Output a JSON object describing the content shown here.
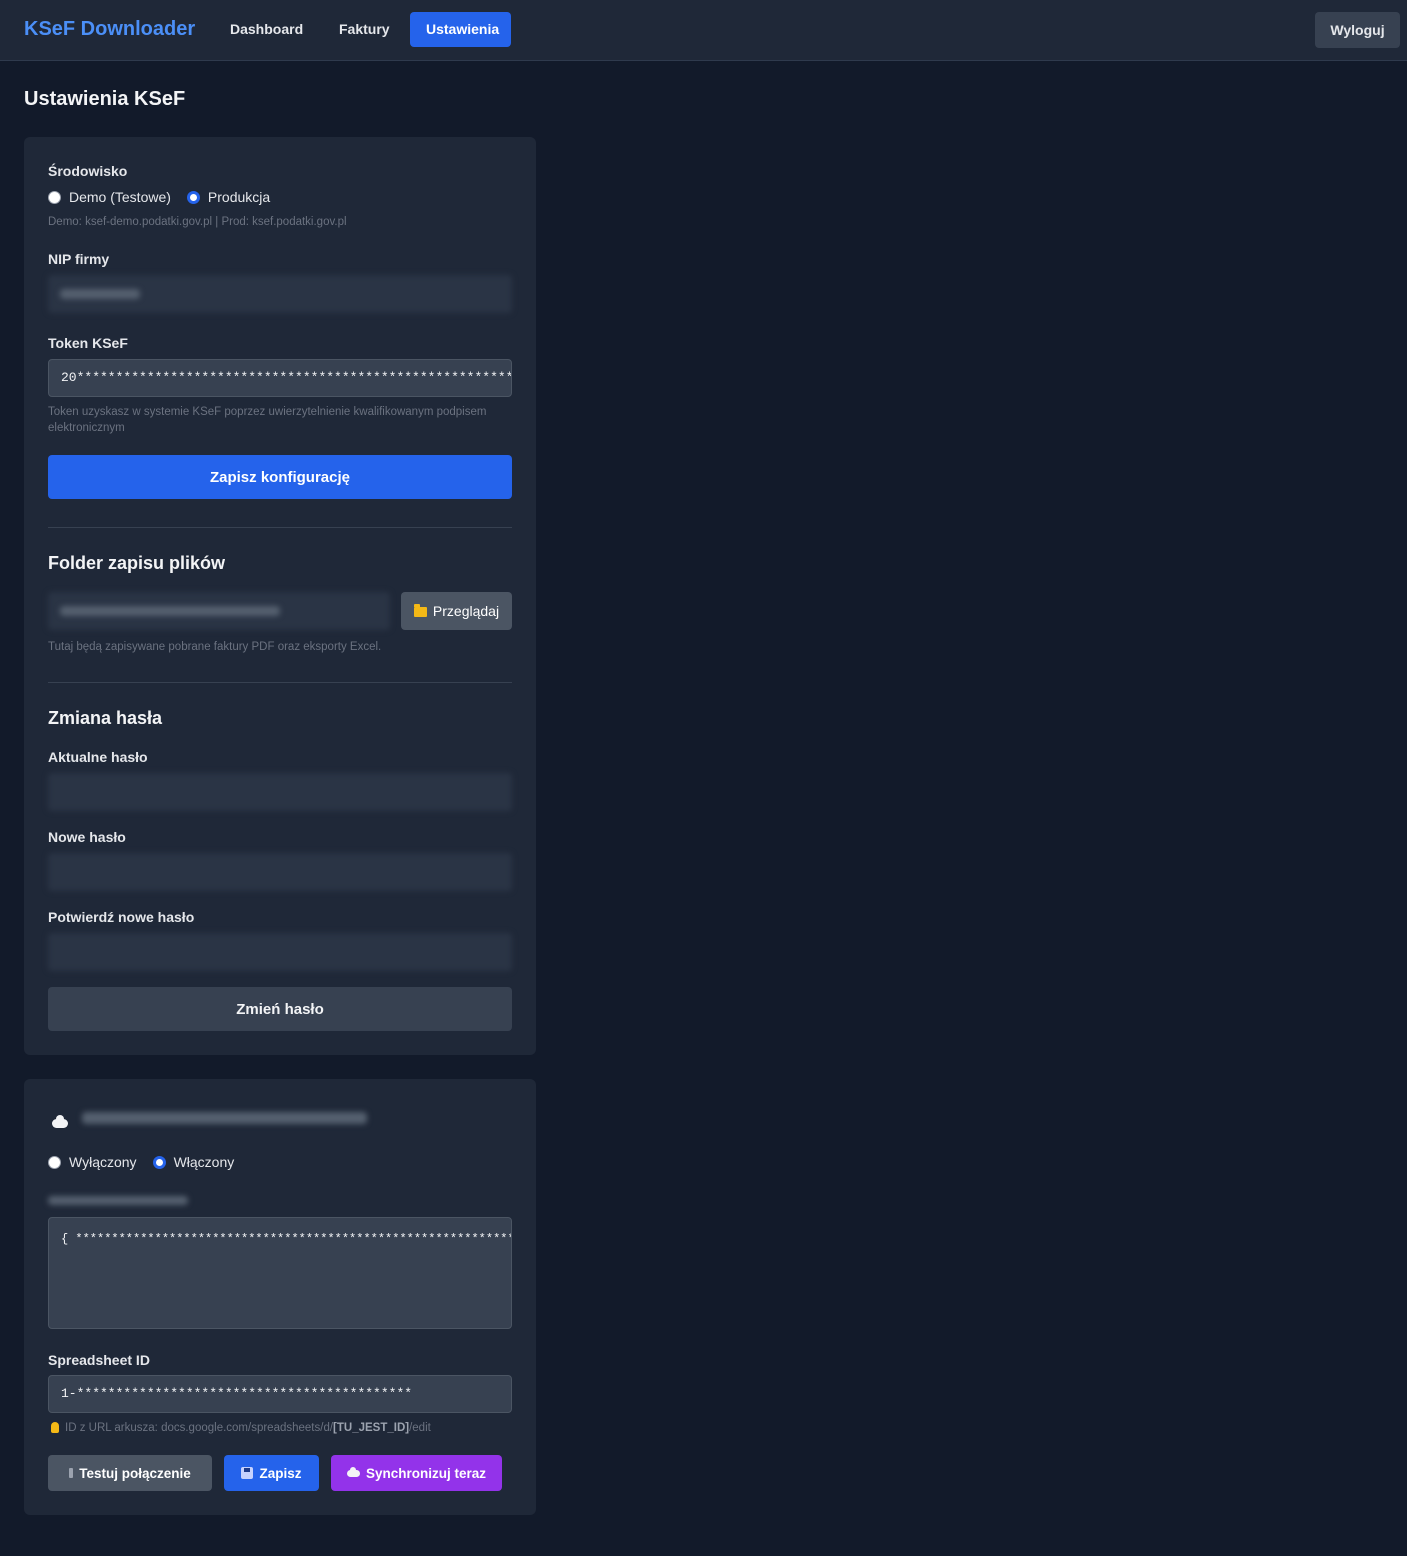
{
  "header": {
    "brand": "KSeF Downloader",
    "nav": [
      "Dashboard",
      "Faktury",
      "Ustawienia"
    ],
    "logout": "Wyloguj"
  },
  "page": {
    "title": "Ustawienia KSeF"
  },
  "config": {
    "env_label": "Środowisko",
    "env_options": [
      "Demo (Testowe)",
      "Produkcja"
    ],
    "env_selected": "Produkcja",
    "env_hint": "Demo: ksef-demo.podatki.gov.pl | Prod: ksef.podatki.gov.pl",
    "nip_label": "NIP firmy",
    "token_label": "Token KSeF",
    "token_value": "20*************************************************************",
    "token_hint": "Token uzyskasz w systemie KSeF poprzez uwierzytelnienie kwalifikowanym podpisem elektronicznym",
    "save_button": "Zapisz konfigurację"
  },
  "folder": {
    "title": "Folder zapisu plików",
    "browse_button": "Przeglądaj",
    "hint": "Tutaj będą zapisywane pobrane faktury PDF oraz eksporty Excel."
  },
  "password": {
    "title": "Zmiana hasła",
    "current_label": "Aktualne hasło",
    "new_label": "Nowe hasło",
    "confirm_label": "Potwierdź nowe hasło",
    "button": "Zmień hasło"
  },
  "sheets": {
    "toggle_options": [
      "Wyłączony",
      "Włączony"
    ],
    "toggle_selected": "Włączony",
    "json_value": "{ *************************************************************…",
    "spreadsheet_label": "Spreadsheet ID",
    "spreadsheet_value": "1-*******************************************",
    "hint_prefix": "ID z URL arkusza: docs.google.com/spreadsheets/d/",
    "hint_bold": "[TU_JEST_ID]",
    "hint_suffix": "/edit",
    "test_button": "Testuj połączenie",
    "save_button": "Zapisz",
    "sync_button": "Synchronizuj teraz"
  },
  "colors": {
    "background": "#121a2a",
    "card": "#1f2838",
    "accent": "#2563eb",
    "brand": "#4b8ff7",
    "sync": "#9333ea"
  },
  "icons": [
    "folder-icon",
    "cloud-icon",
    "plug-icon",
    "floppy-icon",
    "bulb-icon"
  ]
}
